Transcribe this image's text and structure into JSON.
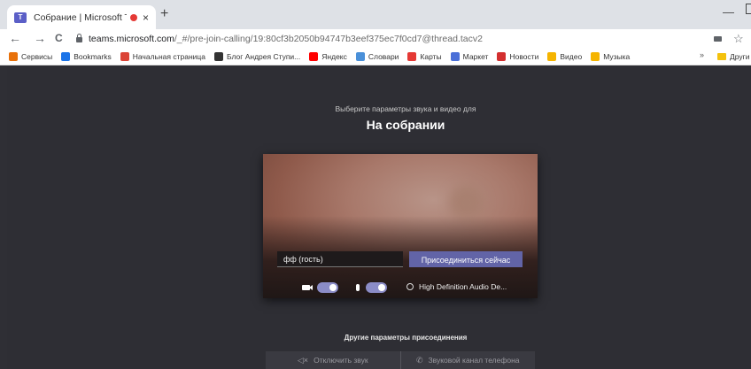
{
  "browser": {
    "tab": {
      "title": "Собрание | Microsoft Teams",
      "close": "×"
    },
    "new_tab": "+",
    "minimize": "—",
    "nav": {
      "back": "←",
      "forward": "→",
      "reload": "C"
    },
    "url": {
      "host": "teams.microsoft.com",
      "path": "/_#/pre-join-calling/19:80cf3b2050b94747b3eef375ec7f0cd7@thread.tacv2"
    },
    "star": "☆",
    "bookmarks": [
      {
        "label": "Сервисы",
        "color": "#e8710a"
      },
      {
        "label": "Bookmarks",
        "color": "#1a73e8"
      },
      {
        "label": "Начальная страница",
        "color": "#db4437"
      },
      {
        "label": "Блог Андрея Ступи...",
        "color": "#333333"
      },
      {
        "label": "Яндекс",
        "color": "#ff0000"
      },
      {
        "label": "Словари",
        "color": "#4a90d9"
      },
      {
        "label": "Карты",
        "color": "#e53935"
      },
      {
        "label": "Маркет",
        "color": "#4a6fd8"
      },
      {
        "label": "Новости",
        "color": "#d32f2f"
      },
      {
        "label": "Видео",
        "color": "#f5b400"
      },
      {
        "label": "Музыка",
        "color": "#f5b400"
      }
    ],
    "bookmarks_more": "»",
    "bookmarks_other": "Други"
  },
  "prejoin": {
    "subtitle": "Выберите параметры звука и видео для",
    "title": "На собрании",
    "name_value": "фф (гость)",
    "join_label": "Присоединиться сейчас",
    "camera_on": true,
    "mic_on": true,
    "device_label": "High Definition Audio De...",
    "other_options_label": "Другие параметры присоединения",
    "options": [
      {
        "icon": "speaker-off-icon",
        "label": "Отключить звук"
      },
      {
        "icon": "phone-icon",
        "label": "Звуковой канал телефона"
      }
    ]
  }
}
